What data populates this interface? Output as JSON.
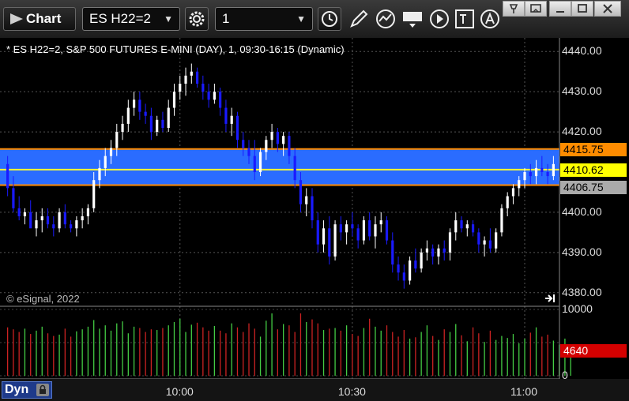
{
  "toolbar": {
    "title": "Chart",
    "symbol": "ES H22=2",
    "interval": "1"
  },
  "chart_header": "* ES H22=2, S&P 500 FUTURES E-MINI (DAY), 1, 09:30-16:15 (Dynamic)",
  "watermark": "© eSignal, 2022",
  "footer": {
    "mode": "Dyn"
  },
  "price_tags": {
    "upper": "4415.75",
    "last": "4410.62",
    "lower": "4406.75",
    "volume": "4640"
  },
  "colors": {
    "up": "#ffffff",
    "down": "#1a1aff",
    "band": "#2a6cff",
    "band_line": "#ff8c00",
    "mid_line": "#ffff33",
    "vol_up": "#44cc44",
    "vol_down": "#cc2222"
  },
  "chart_data": {
    "type": "candlestick",
    "y_ticks": [
      4380,
      4390,
      4400,
      4410,
      4420,
      4430,
      4440
    ],
    "y_tick_labels": [
      "4380.00",
      "4390.00",
      "4400.00",
      "",
      "4420.00",
      "4430.00",
      "4440.00"
    ],
    "ylim": [
      4377,
      4443
    ],
    "x_ticks": [
      {
        "label": "10:00",
        "index": 30
      },
      {
        "label": "10:30",
        "index": 60
      },
      {
        "label": "11:00",
        "index": 90
      }
    ],
    "band": {
      "upper": 4415.75,
      "lower": 4406.75,
      "mid": 4410.62
    },
    "volume_ticks": [
      0,
      5000,
      10000
    ],
    "volume_tick_labels": [
      "0",
      "",
      "10000"
    ],
    "volume_ylim": [
      0,
      10000
    ],
    "ohlc": [
      [
        4412,
        4414,
        4404,
        4406
      ],
      [
        4406,
        4409,
        4400,
        4401
      ],
      [
        4401,
        4404,
        4398,
        4399
      ],
      [
        4399,
        4401,
        4397,
        4400
      ],
      [
        4400,
        4403,
        4398,
        4396
      ],
      [
        4396,
        4400,
        4394,
        4398
      ],
      [
        4398,
        4401,
        4395,
        4399
      ],
      [
        4399,
        4401,
        4396,
        4397
      ],
      [
        4397,
        4399,
        4394,
        4396
      ],
      [
        4396,
        4401,
        4395,
        4400
      ],
      [
        4400,
        4402,
        4396,
        4397
      ],
      [
        4397,
        4398,
        4395,
        4396
      ],
      [
        4396,
        4399,
        4394,
        4398
      ],
      [
        4398,
        4401,
        4396,
        4399
      ],
      [
        4399,
        4402,
        4397,
        4401
      ],
      [
        4401,
        4410,
        4400,
        4408
      ],
      [
        4408,
        4413,
        4406,
        4411
      ],
      [
        4411,
        4416,
        4409,
        4414
      ],
      [
        4414,
        4418,
        4412,
        4416
      ],
      [
        4416,
        4422,
        4414,
        4420
      ],
      [
        4420,
        4424,
        4418,
        4422
      ],
      [
        4422,
        4428,
        4420,
        4426
      ],
      [
        4426,
        4430,
        4424,
        4428
      ],
      [
        4428,
        4430,
        4423,
        4425
      ],
      [
        4425,
        4427,
        4422,
        4424
      ],
      [
        4424,
        4426,
        4418,
        4420
      ],
      [
        4420,
        4424,
        4419,
        4423
      ],
      [
        4423,
        4425,
        4420,
        4421
      ],
      [
        4421,
        4428,
        4420,
        4426
      ],
      [
        4426,
        4432,
        4424,
        4430
      ],
      [
        4430,
        4434,
        4428,
        4432
      ],
      [
        4432,
        4436,
        4429,
        4434
      ],
      [
        4434,
        4437,
        4432,
        4435
      ],
      [
        4435,
        4436,
        4431,
        4432
      ],
      [
        4432,
        4434,
        4428,
        4430
      ],
      [
        4430,
        4432,
        4426,
        4428
      ],
      [
        4428,
        4432,
        4427,
        4430
      ],
      [
        4430,
        4431,
        4424,
        4426
      ],
      [
        4426,
        4428,
        4420,
        4422
      ],
      [
        4422,
        4426,
        4419,
        4424
      ],
      [
        4424,
        4425,
        4416,
        4418
      ],
      [
        4418,
        4420,
        4414,
        4416
      ],
      [
        4416,
        4418,
        4412,
        4414
      ],
      [
        4414,
        4418,
        4408,
        4410
      ],
      [
        4410,
        4416,
        4409,
        4415
      ],
      [
        4415,
        4419,
        4413,
        4418
      ],
      [
        4418,
        4422,
        4416,
        4420
      ],
      [
        4420,
        4421,
        4415,
        4417
      ],
      [
        4417,
        4420,
        4414,
        4419
      ],
      [
        4419,
        4420,
        4412,
        4414
      ],
      [
        4414,
        4416,
        4406,
        4408
      ],
      [
        4408,
        4410,
        4400,
        4402
      ],
      [
        4402,
        4406,
        4399,
        4404
      ],
      [
        4404,
        4406,
        4396,
        4398
      ],
      [
        4398,
        4400,
        4390,
        4392
      ],
      [
        4392,
        4398,
        4390,
        4396
      ],
      [
        4396,
        4399,
        4387,
        4389
      ],
      [
        4389,
        4398,
        4388,
        4397
      ],
      [
        4397,
        4399,
        4393,
        4395
      ],
      [
        4395,
        4398,
        4392,
        4397
      ],
      [
        4397,
        4400,
        4394,
        4396
      ],
      [
        4396,
        4397,
        4391,
        4393
      ],
      [
        4393,
        4399,
        4392,
        4398
      ],
      [
        4398,
        4400,
        4393,
        4394
      ],
      [
        4394,
        4399,
        4391,
        4397
      ],
      [
        4397,
        4400,
        4395,
        4398
      ],
      [
        4398,
        4399,
        4392,
        4393
      ],
      [
        4393,
        4395,
        4385,
        4387
      ],
      [
        4387,
        4389,
        4383,
        4385
      ],
      [
        4385,
        4387,
        4381,
        4383
      ],
      [
        4383,
        4389,
        4382,
        4388
      ],
      [
        4388,
        4391,
        4385,
        4386
      ],
      [
        4386,
        4391,
        4385,
        4390
      ],
      [
        4390,
        4393,
        4388,
        4391
      ],
      [
        4391,
        4392,
        4387,
        4389
      ],
      [
        4389,
        4392,
        4387,
        4391
      ],
      [
        4391,
        4393,
        4388,
        4390
      ],
      [
        4390,
        4396,
        4388,
        4395
      ],
      [
        4395,
        4400,
        4393,
        4398
      ],
      [
        4398,
        4399,
        4395,
        4396
      ],
      [
        4396,
        4398,
        4394,
        4397
      ],
      [
        4397,
        4398,
        4394,
        4395
      ],
      [
        4395,
        4396,
        4390,
        4392
      ],
      [
        4392,
        4394,
        4389,
        4393
      ],
      [
        4393,
        4396,
        4390,
        4391
      ],
      [
        4391,
        4396,
        4390,
        4395
      ],
      [
        4395,
        4402,
        4394,
        4401
      ],
      [
        4401,
        4405,
        4399,
        4404
      ],
      [
        4404,
        4407,
        4402,
        4406
      ],
      [
        4406,
        4409,
        4404,
        4408
      ],
      [
        4408,
        4411,
        4406,
        4410
      ],
      [
        4410,
        4412,
        4407,
        4409
      ],
      [
        4409,
        4413,
        4407,
        4411
      ],
      [
        4411,
        4414,
        4409,
        4410
      ],
      [
        4410,
        4412,
        4407,
        4409
      ],
      [
        4409,
        4414,
        4408,
        4412
      ]
    ],
    "volume": [
      7300,
      7000,
      6600,
      7100,
      6300,
      6800,
      7400,
      6400,
      6000,
      6200,
      7100,
      5900,
      6700,
      7000,
      7400,
      8400,
      7100,
      7600,
      6800,
      7900,
      8200,
      6400,
      7400,
      7200,
      6600,
      7000,
      6900,
      7200,
      7600,
      8100,
      8600,
      6600,
      7700,
      8000,
      7300,
      6800,
      7500,
      6800,
      6400,
      7900,
      7300,
      6600,
      7900,
      7100,
      5900,
      8300,
      9400,
      7000,
      7800,
      7600,
      6600,
      9400,
      8100,
      8500,
      7900,
      6900,
      7100,
      7200,
      6800,
      7600,
      6300,
      6000,
      7200,
      8600,
      7400,
      6800,
      7600,
      6600,
      5900,
      6900,
      5600,
      5800,
      6600,
      7600,
      6000,
      5400,
      7000,
      6600,
      7800,
      6100,
      5200,
      7300,
      6400,
      5100,
      6800,
      5400,
      6000,
      5700,
      6300,
      4900,
      5600,
      6500,
      7300,
      5900,
      6200,
      5300,
      4700,
      5600,
      4640
    ]
  }
}
